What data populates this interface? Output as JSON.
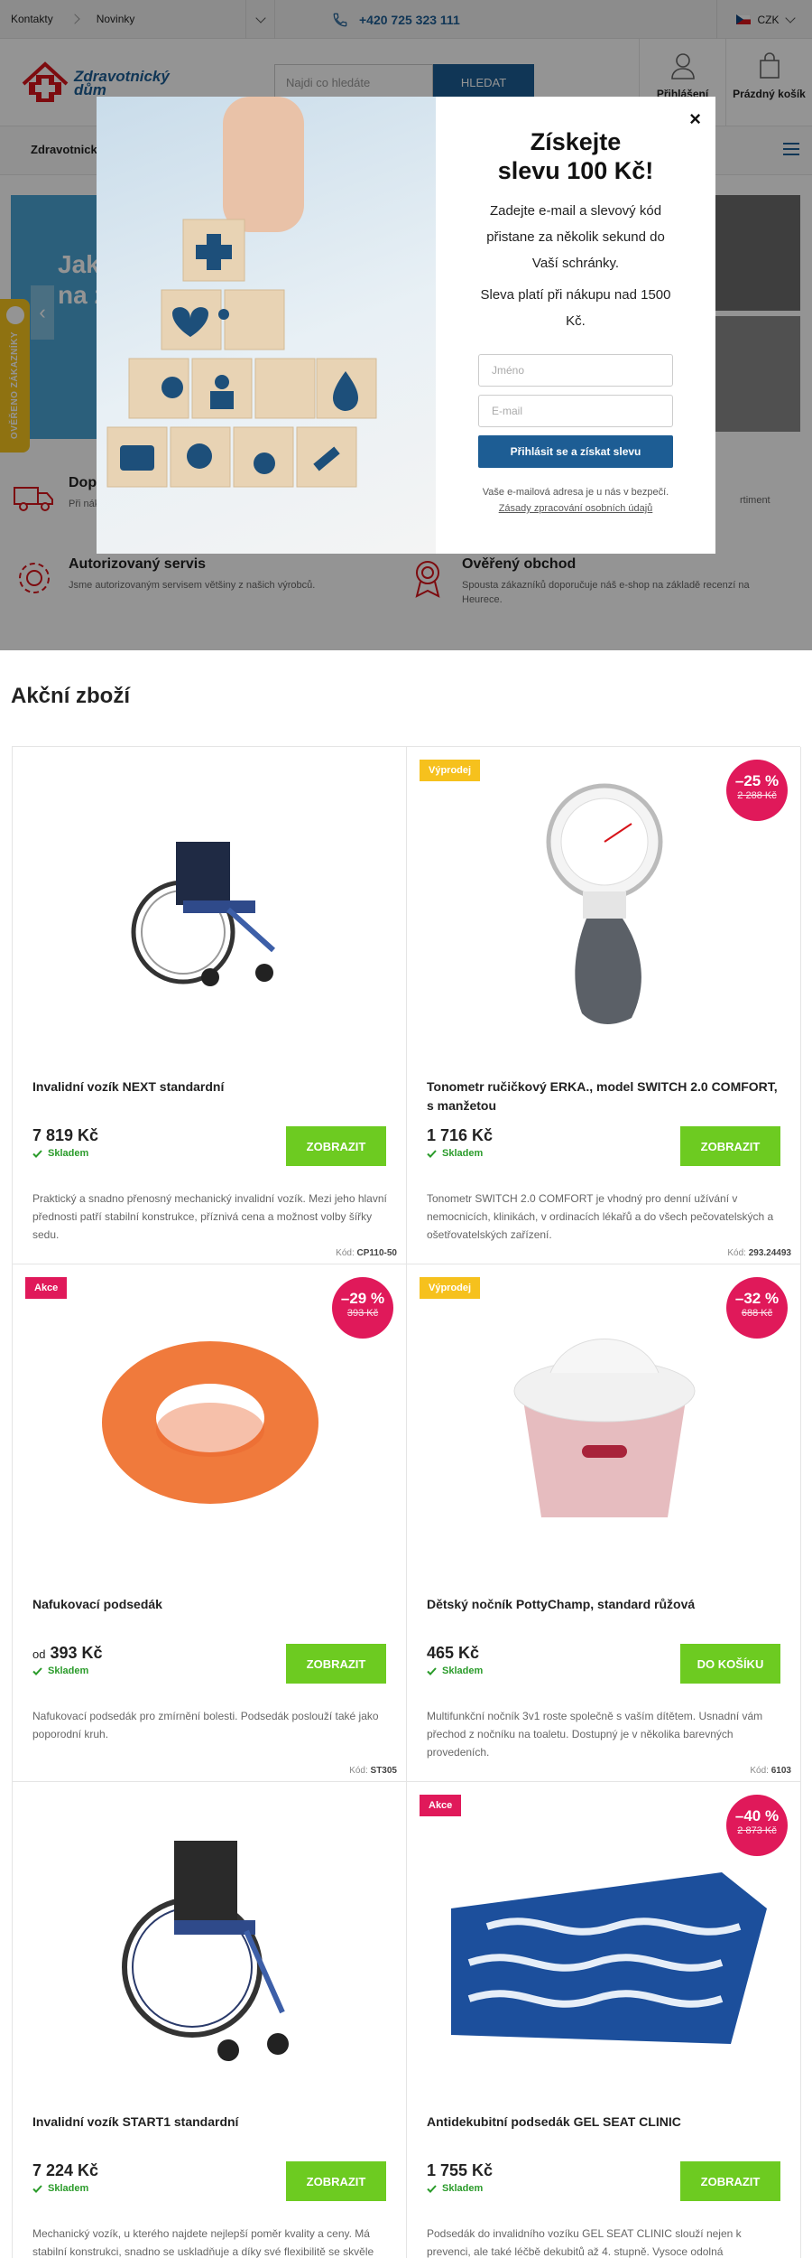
{
  "topbar": {
    "links": [
      "Kontakty",
      "Novinky"
    ],
    "phone": "+420 725 323 111",
    "currency": "CZK"
  },
  "header": {
    "logo_line1": "Zdravotnický",
    "logo_line2": "dům",
    "search_placeholder": "Najdi co hledáte",
    "search_button": "HLEDAT",
    "login": "Přihlášení",
    "cart": "Prázdný košík"
  },
  "nav": {
    "first": "Zdravotnick",
    "last": "k"
  },
  "hero": {
    "banner_text_1": "Jak",
    "banner_text_2": "na zd",
    "arrow": "‹"
  },
  "side_badge": "OVĚŘENO ZÁKAZNÍKY",
  "features": [
    {
      "title": "Dopr",
      "text": "Při nák",
      "tail": "rtiment"
    },
    {
      "title": "Autorizovaný servis",
      "text": "Jsme autorizovaným servisem většiny z našich výrobců."
    },
    {
      "title": "Ověřený obchod",
      "text": "Spousta zákazníků doporučuje náš e-shop na základě recenzí na Heurece."
    }
  ],
  "modal": {
    "close": "×",
    "title_1": "Získejte",
    "title_2": "slevu 100 Kč!",
    "p1": "Zadejte e-mail a slevový kód přistane za několik sekund do Vaší schránky.",
    "p2": "Sleva platí při nákupu nad 1500 Kč.",
    "name_placeholder": "Jméno",
    "email_placeholder": "E-mail",
    "submit": "Přihlásit se a získat slevu",
    "note": "Vaše e-mailová adresa je u nás v bezpečí.",
    "privacy": "Zásady zpracování osobních údajů"
  },
  "section_title": "Akční zboží",
  "products": [
    {
      "name": "Invalidní vozík NEXT standardní",
      "price": "7 819 Kč",
      "prefix": "",
      "stock": "Skladem",
      "button": "ZOBRAZIT",
      "desc": "Praktický a snadno přenosný mechanický invalidní vozík. Mezi jeho hlavní přednosti patří stabilní konstrukce, příznivá cena a možnost volby šířky sedu.",
      "code_label": "Kód:",
      "code": "CP110-50",
      "tag": "",
      "disc": "",
      "old": ""
    },
    {
      "name": "Tonometr ručičkový ERKA., model SWITCH 2.0 COMFORT, s manžetou",
      "price": "1 716 Kč",
      "prefix": "",
      "stock": "Skladem",
      "button": "ZOBRAZIT",
      "desc": "Tonometr SWITCH 2.0 COMFORT je vhodný pro denní užívání v nemocnicích, klinikách, v ordinacích lékařů a do všech pečovatelských a ošetřovatelských zařízení.",
      "code_label": "Kód:",
      "code": "293.24493",
      "tag": "Výprodej",
      "disc": "–25 %",
      "old": "2 288 Kč"
    },
    {
      "name": "Nafukovací podsedák",
      "price": "393 Kč",
      "prefix": "od",
      "stock": "Skladem",
      "button": "ZOBRAZIT",
      "desc": "Nafukovací podsedák pro zmírnění bolesti. Podsedák poslouží také jako poporodní kruh.",
      "code_label": "Kód:",
      "code": "ST305",
      "tag": "Akce",
      "disc": "–29 %",
      "old": "393 Kč"
    },
    {
      "name": "Dětský nočník PottyChamp, standard růžová",
      "price": "465 Kč",
      "prefix": "",
      "stock": "Skladem",
      "button": "DO KOŠÍKU",
      "desc": "Multifunkční nočník 3v1 roste společně s vaším dítětem. Usnadní vám přechod z nočníku na toaletu. Dostupný je v několika barevných provedeních.",
      "code_label": "Kód:",
      "code": "6103",
      "tag": "Výprodej",
      "disc": "–32 %",
      "old": "688 Kč"
    },
    {
      "name": "Invalidní vozík START1 standardní",
      "price": "7 224 Kč",
      "prefix": "",
      "stock": "Skladem",
      "button": "ZOBRAZIT",
      "desc": "Mechanický vozík, u kterého najdete nejlepší poměr kvality a ceny. Má stabilní konstrukci, snadno se uskladňuje a díky své flexibilitě se skvěle",
      "code_label": "",
      "code": "",
      "tag": "",
      "disc": "",
      "old": ""
    },
    {
      "name": "Antidekubitní podsedák GEL SEAT CLINIC",
      "price": "1 755 Kč",
      "prefix": "",
      "stock": "Skladem",
      "button": "ZOBRAZIT",
      "desc": "Podsedák do invalidního vozíku GEL SEAT CLINIC slouží nejen k prevenci, ale také léčbě dekubitů až 4. stupně. Vysoce odolná",
      "code_label": "",
      "code": "",
      "tag": "Akce",
      "disc": "–40 %",
      "old": "2 873 Kč"
    }
  ]
}
